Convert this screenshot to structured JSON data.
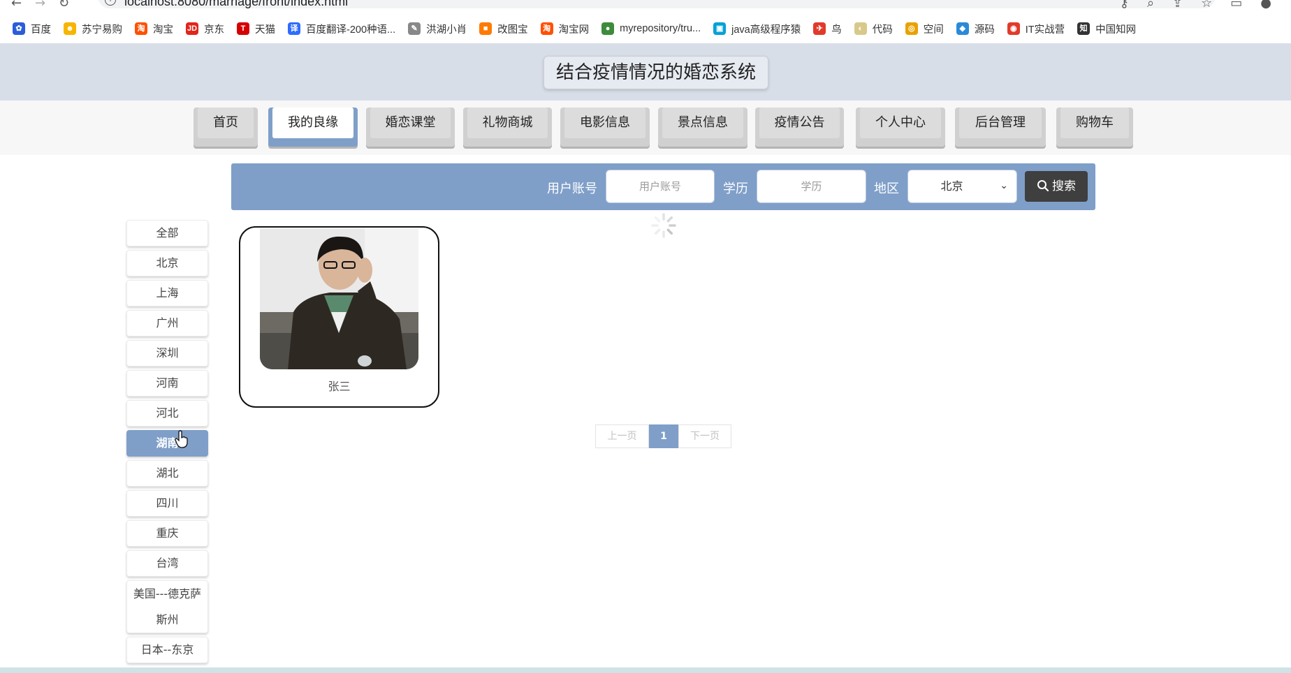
{
  "browser": {
    "url": "localhost:8080/marriage/front/index.html",
    "bookmarks": [
      {
        "label": "百度",
        "color": "#2a5cdc",
        "glyph": "✿"
      },
      {
        "label": "苏宁易购",
        "color": "#f7b500",
        "glyph": "☻"
      },
      {
        "label": "淘宝",
        "color": "#ff5000",
        "glyph": "淘"
      },
      {
        "label": "京东",
        "color": "#e1251b",
        "glyph": "JD"
      },
      {
        "label": "天猫",
        "color": "#d60000",
        "glyph": "T"
      },
      {
        "label": "百度翻译-200种语...",
        "color": "#2f6bff",
        "glyph": "译"
      },
      {
        "label": "洪湖小肖",
        "color": "#888888",
        "glyph": "✎"
      },
      {
        "label": "改图宝",
        "color": "#ff7a00",
        "glyph": "■"
      },
      {
        "label": "淘宝网",
        "color": "#ff5000",
        "glyph": "淘"
      },
      {
        "label": "myrepository/tru...",
        "color": "#3c8c3c",
        "glyph": "●"
      },
      {
        "label": "java高级程序猿",
        "color": "#00a1d6",
        "glyph": "▣"
      },
      {
        "label": "鸟",
        "color": "#e23a2a",
        "glyph": "✈"
      },
      {
        "label": "代码",
        "color": "#d8c98a",
        "glyph": "◐"
      },
      {
        "label": "空间",
        "color": "#e8a200",
        "glyph": "◎"
      },
      {
        "label": "源码",
        "color": "#2a8ad8",
        "glyph": "◆"
      },
      {
        "label": "IT实战营",
        "color": "#e23a2a",
        "glyph": "◉"
      },
      {
        "label": "中国知网",
        "color": "#333333",
        "glyph": "知"
      }
    ]
  },
  "header": {
    "title": "结合疫情情况的婚恋系统"
  },
  "nav": {
    "items": [
      {
        "label": "首页"
      },
      {
        "label": "我的良缘"
      },
      {
        "label": "婚恋课堂"
      },
      {
        "label": "礼物商城"
      },
      {
        "label": "电影信息"
      },
      {
        "label": "景点信息"
      },
      {
        "label": "疫情公告"
      },
      {
        "label": "个人中心"
      },
      {
        "label": "后台管理"
      },
      {
        "label": "购物车"
      }
    ],
    "active": "我的良缘"
  },
  "search": {
    "account_label": "用户账号",
    "account_placeholder": "用户账号",
    "education_label": "学历",
    "education_placeholder": "学历",
    "region_label": "地区",
    "region_value": "北京",
    "button_label": "搜索"
  },
  "regions": {
    "items": [
      "全部",
      "北京",
      "上海",
      "广州",
      "深圳",
      "河南",
      "河北",
      "湖南",
      "湖北",
      "四川",
      "重庆",
      "台湾",
      "美国---德克萨斯州",
      "日本--东京"
    ],
    "active": "湖南"
  },
  "results": [
    {
      "name": "张三"
    }
  ],
  "pagination": {
    "prev_label": "上一页",
    "current_page": "1",
    "next_label": "下一页"
  }
}
